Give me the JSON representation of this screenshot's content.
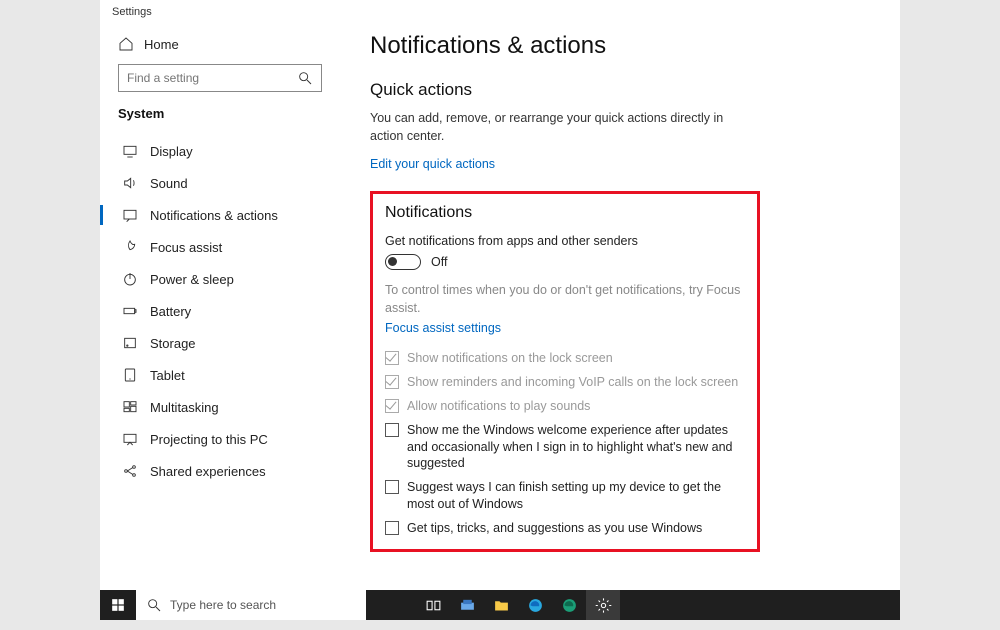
{
  "window_title": "Settings",
  "sidebar": {
    "home_label": "Home",
    "search_placeholder": "Find a setting",
    "section": "System",
    "items": [
      {
        "label": "Display"
      },
      {
        "label": "Sound"
      },
      {
        "label": "Notifications & actions"
      },
      {
        "label": "Focus assist"
      },
      {
        "label": "Power & sleep"
      },
      {
        "label": "Battery"
      },
      {
        "label": "Storage"
      },
      {
        "label": "Tablet"
      },
      {
        "label": "Multitasking"
      },
      {
        "label": "Projecting to this PC"
      },
      {
        "label": "Shared experiences"
      }
    ]
  },
  "main": {
    "title": "Notifications & actions",
    "quick_actions": {
      "heading": "Quick actions",
      "desc": "You can add, remove, or rearrange your quick actions directly in action center.",
      "edit_link": "Edit your quick actions"
    },
    "notifications": {
      "heading": "Notifications",
      "toggle_label": "Get notifications from apps and other senders",
      "toggle_state": "Off",
      "hint": "To control times when you do or don't get notifications, try Focus assist.",
      "focus_link": "Focus assist settings",
      "checkboxes": [
        {
          "label": "Show notifications on the lock screen",
          "checked": true,
          "disabled": true
        },
        {
          "label": "Show reminders and incoming VoIP calls on the lock screen",
          "checked": true,
          "disabled": true
        },
        {
          "label": "Allow notifications to play sounds",
          "checked": true,
          "disabled": true
        },
        {
          "label": "Show me the Windows welcome experience after updates and occasionally when I sign in to highlight what's new and suggested",
          "checked": false,
          "disabled": false
        },
        {
          "label": "Suggest ways I can finish setting up my device to get the most out of Windows",
          "checked": false,
          "disabled": false
        },
        {
          "label": "Get tips, tricks, and suggestions as you use Windows",
          "checked": false,
          "disabled": false
        }
      ]
    }
  },
  "taskbar": {
    "search_placeholder": "Type here to search"
  }
}
